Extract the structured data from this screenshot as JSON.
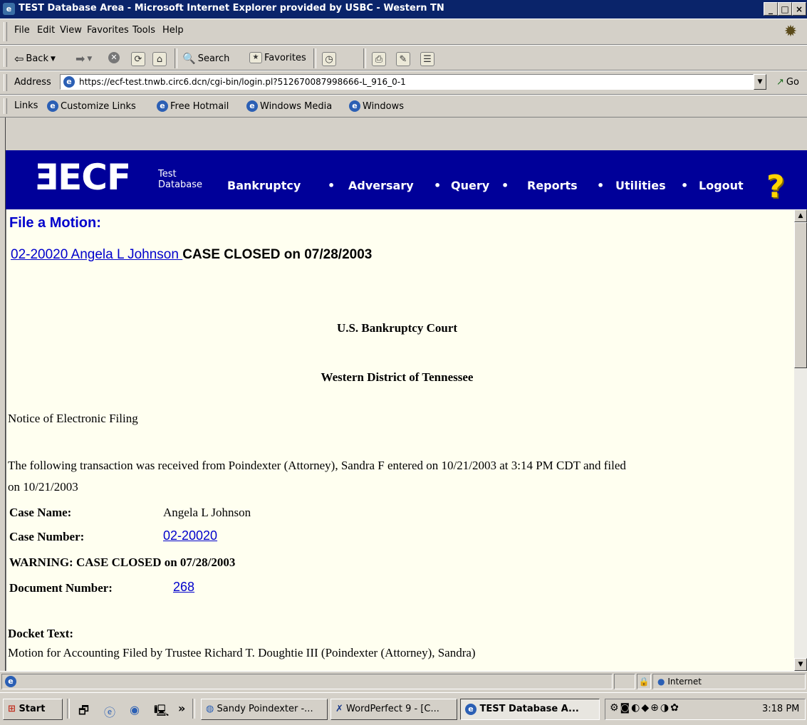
{
  "window": {
    "title": "TEST Database Area - Microsoft Internet Explorer provided by USBC - Western TN",
    "controls": [
      "_",
      "□",
      "×"
    ]
  },
  "menu": [
    "File",
    "Edit",
    "View",
    "Favorites",
    "Tools",
    "Help"
  ],
  "toolbar": {
    "back": "Back",
    "search": "Search",
    "favorites": "Favorites"
  },
  "address": {
    "label": "Address",
    "url": "https://ecf-test.tnwb.circ6.dcn/cgi-bin/login.pl?512670087998666-L_916_0-1",
    "go": "Go"
  },
  "links": {
    "label": "Links",
    "items": [
      "Customize Links",
      "Free Hotmail",
      "Windows Media",
      "Windows"
    ]
  },
  "ecf": {
    "logo": "ƎECF",
    "test_line1": "Test",
    "test_line2": "Database",
    "nav": [
      "Bankruptcy",
      "Adversary",
      "Query",
      "Reports",
      "Utilities",
      "Logout"
    ],
    "help": "?"
  },
  "page": {
    "heading": "File a Motion:",
    "case_link": "02-20020 Angela L Johnson ",
    "case_closed": "CASE CLOSED on 07/28/2003",
    "court": "U.S. Bankruptcy Court",
    "district": "Western District of Tennessee",
    "notice": "Notice of Electronic Filing",
    "transaction_line1": "The following transaction was received from Poindexter (Attorney), Sandra F entered on 10/21/2003 at 3:14 PM CDT and filed",
    "transaction_line2": "on 10/21/2003",
    "case_name_label": "Case Name:",
    "case_name_value": "Angela L Johnson",
    "case_number_label": "Case Number:",
    "case_number_value": "02-20020",
    "warning": "WARNING: CASE CLOSED on 07/28/2003",
    "doc_number_label": "Document Number:",
    "doc_number_value": "268",
    "docket_label": "Docket Text:",
    "docket_text": "Motion for Accounting Filed by Trustee Richard T. Doughtie III (Poindexter (Attorney), Sandra)"
  },
  "status": {
    "zone": "Internet"
  },
  "taskbar": {
    "start": "Start",
    "chevron": "»",
    "buttons": [
      "Sandy Poindexter -...",
      "WordPerfect 9 - [C...",
      "TEST Database A..."
    ],
    "clock": "3:18 PM"
  }
}
